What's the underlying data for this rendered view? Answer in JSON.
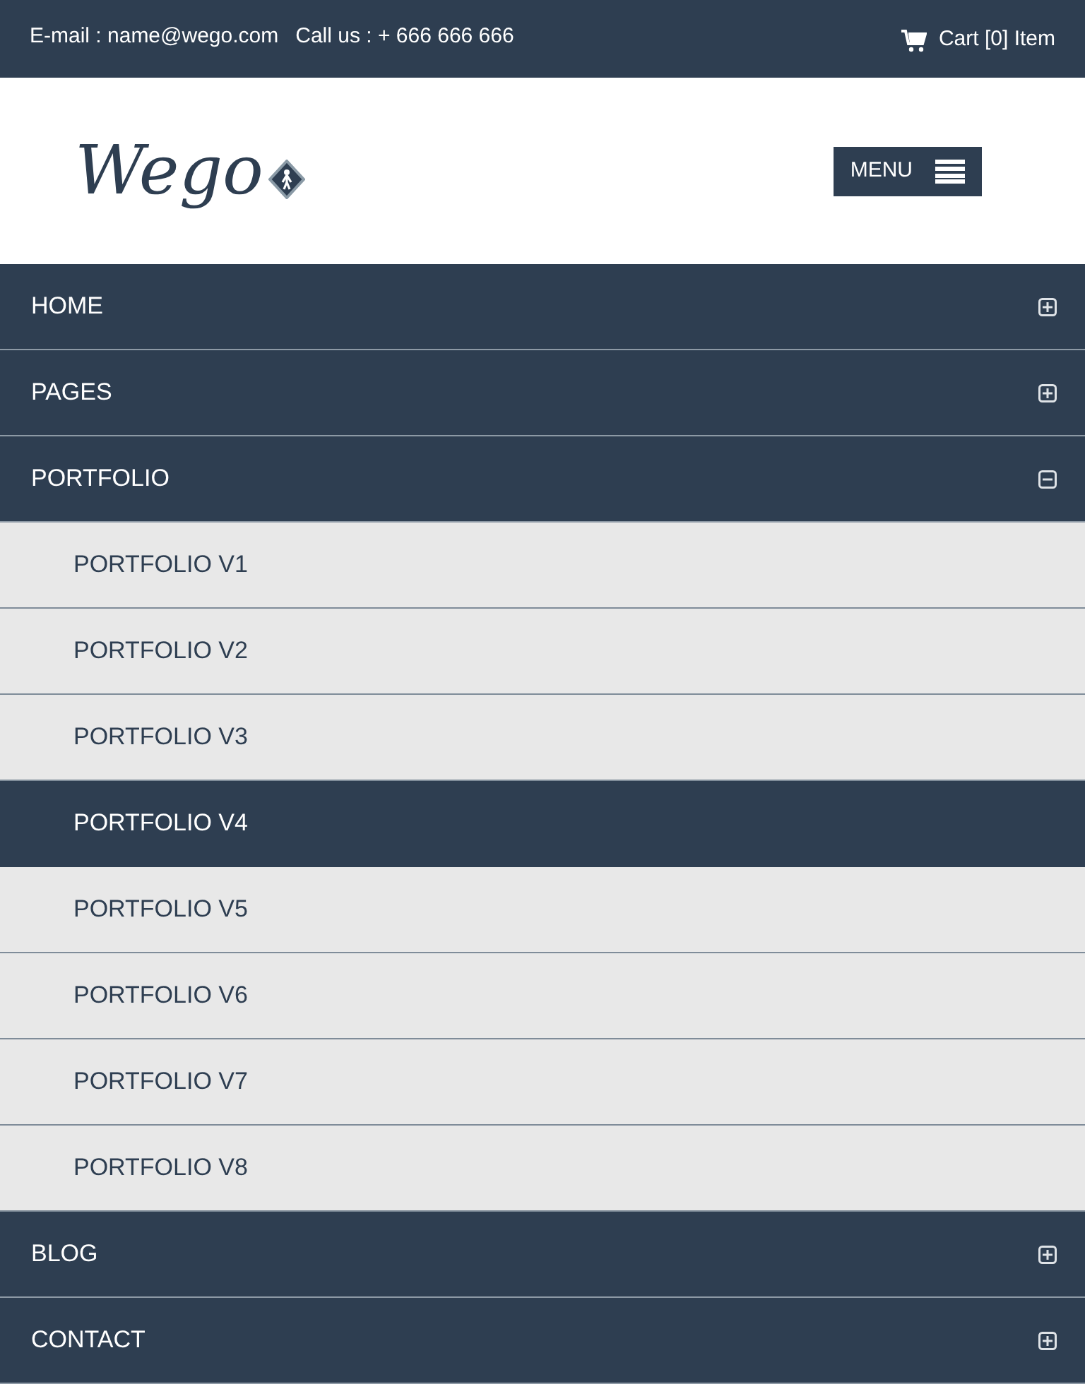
{
  "top_bar": {
    "email": "E-mail : name@wego.com",
    "phone": "Call us : + 666 666 666",
    "cart": "Cart [0] Item"
  },
  "logo": {
    "text": "Wego"
  },
  "menu_button": {
    "label": "MENU"
  },
  "nav": [
    {
      "label": "HOME",
      "expanded": false
    },
    {
      "label": "PAGES",
      "expanded": false
    },
    {
      "label": "PORTFOLIO",
      "expanded": true,
      "children": [
        {
          "label": "PORTFOLIO V1",
          "selected": false
        },
        {
          "label": "PORTFOLIO V2",
          "selected": false
        },
        {
          "label": "PORTFOLIO V3",
          "selected": false
        },
        {
          "label": "PORTFOLIO V4",
          "selected": true
        },
        {
          "label": "PORTFOLIO V5",
          "selected": false
        },
        {
          "label": "PORTFOLIO V6",
          "selected": false
        },
        {
          "label": "PORTFOLIO V7",
          "selected": false
        },
        {
          "label": "PORTFOLIO V8",
          "selected": false
        }
      ]
    },
    {
      "label": "BLOG",
      "expanded": false
    },
    {
      "label": "CONTACT",
      "expanded": false
    }
  ]
}
